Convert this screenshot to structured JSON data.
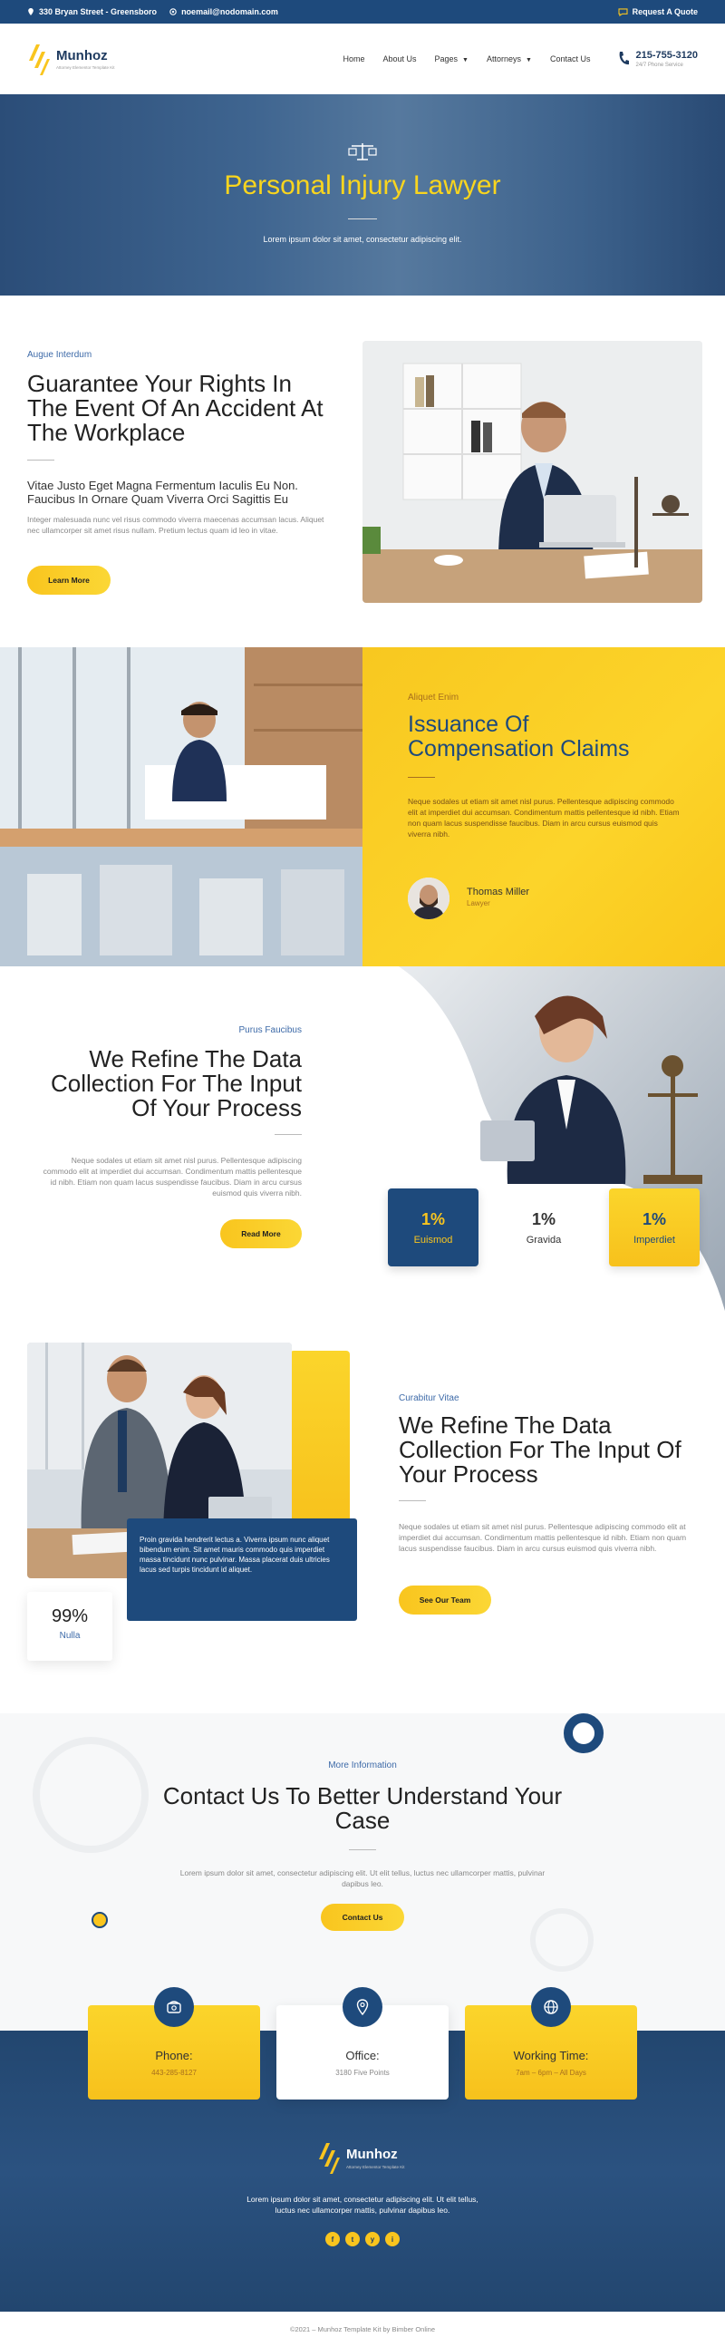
{
  "topbar": {
    "address": "330 Bryan Street - Greensboro",
    "email": "noemail@nodomain.com",
    "quote": "Request A Quote"
  },
  "header": {
    "logo_name": "Munhoz",
    "logo_tagline": "Attorney Elementor Template Kit",
    "nav": [
      "Home",
      "About Us",
      "Pages",
      "Attorneys",
      "Contact Us"
    ],
    "phone": "215-755-3120",
    "phone_sub": "24/7 Phone Service"
  },
  "hero": {
    "title": "Personal Injury Lawyer",
    "subtitle": "Lorem ipsum dolor sit amet, consectetur adipiscing elit."
  },
  "guarantee": {
    "eyebrow": "Augue Interdum",
    "title": "Guarantee Your Rights In The Event Of An Accident At The Workplace",
    "lead": "Vitae Justo Eget Magna Fermentum Iaculis Eu Non. Faucibus In Ornare Quam Viverra Orci Sagittis Eu",
    "body": "Integer malesuada nunc vel risus commodo viverra maecenas accumsan lacus. Aliquet nec ullamcorper sit amet risus nullam. Pretium lectus quam id leo in vitae.",
    "button": "Learn More"
  },
  "issuance": {
    "eyebrow": "Aliquet Enim",
    "title": "Issuance Of Compensation Claims",
    "body": "Neque sodales ut etiam sit amet nisl purus. Pellentesque adipiscing commodo elit at imperdiet dui accumsan. Condimentum mattis pellentesque id nibh. Etiam non quam lacus suspendisse faucibus. Diam in arcu cursus euismod quis viverra nibh.",
    "person_name": "Thomas Miller",
    "person_role": "Lawyer"
  },
  "refine1": {
    "eyebrow": "Purus Faucibus",
    "title": "We Refine The Data Collection For The Input Of Your Process",
    "body": "Neque sodales ut etiam sit amet nisl purus. Pellentesque adipiscing commodo elit at imperdiet dui accumsan. Condimentum mattis pellentesque id nibh. Etiam non quam lacus suspendisse faucibus. Diam in arcu cursus euismod quis viverra nibh.",
    "button": "Read More",
    "stats": [
      {
        "value": "1%",
        "label": "Euismod"
      },
      {
        "value": "1%",
        "label": "Gravida"
      },
      {
        "value": "1%",
        "label": "Imperdiet"
      }
    ]
  },
  "refine2": {
    "eyebrow": "Curabitur Vitae",
    "title": "We Refine The Data Collection For The Input Of Your Process",
    "body": "Neque sodales ut etiam sit amet nisl purus. Pellentesque adipiscing commodo elit at imperdiet dui accumsan. Condimentum mattis pellentesque id nibh. Etiam non quam lacus suspendisse faucibus. Diam in arcu cursus euismod quis viverra nibh.",
    "button": "See Our Team",
    "stat_value": "99%",
    "stat_label": "Nulla",
    "blue_text": "Proin gravida hendrerit lectus a. Viverra ipsum nunc aliquet bibendum enim. Sit amet mauris commodo quis imperdiet massa tincidunt nunc pulvinar. Massa placerat duis ultricies lacus sed turpis tincidunt id aliquet."
  },
  "contact": {
    "eyebrow": "More Information",
    "title": "Contact Us To Better Understand Your Case",
    "body": "Lorem ipsum dolor sit amet, consectetur adipiscing elit. Ut elit tellus, luctus nec ullamcorper mattis, pulvinar dapibus leo.",
    "button": "Contact Us"
  },
  "info_cards": [
    {
      "icon": "phone-icon",
      "title": "Phone:",
      "value": "443-285-8127"
    },
    {
      "icon": "location-icon",
      "title": "Office:",
      "value": "3180 Five Points"
    },
    {
      "icon": "globe-icon",
      "title": "Working Time:",
      "value": "7am – 6pm – All Days"
    }
  ],
  "footer": {
    "logo_name": "Munhoz",
    "logo_tagline": "Attorney Elementor Template Kit",
    "text": "Lorem ipsum dolor sit amet, consectetur adipiscing elit. Ut elit tellus, luctus nec ullamcorper mattis, pulvinar dapibus leo.",
    "social": [
      "f",
      "t",
      "y",
      "i"
    ],
    "copyright": "©2021 – Munhoz Template Kit by Bimber Online"
  },
  "colors": {
    "navy": "#1e4a7c",
    "yellow": "#f9c51e",
    "accent_blue": "#3d6aa8"
  }
}
